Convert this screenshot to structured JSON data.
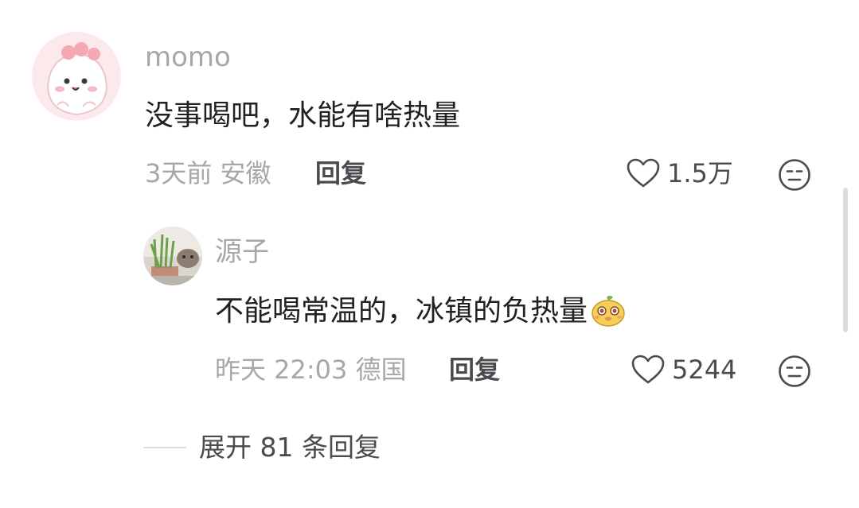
{
  "comment": {
    "username": "momo",
    "text": "没事喝吧，水能有啥热量",
    "time": "3天前",
    "location": "安徽",
    "reply_label": "回复",
    "likes": "1.5万"
  },
  "reply": {
    "username": "源子",
    "text": "不能喝常温的，冰镇的负热量",
    "time": "昨天 22:03",
    "location": "德国",
    "reply_label": "回复",
    "likes": "5244"
  },
  "expand": {
    "label": "展开 81 条回复"
  },
  "icons": {
    "like": "heart-outline-icon",
    "more": "meh-face-icon",
    "emoji": "cute-yellow-face-emoji"
  },
  "colors": {
    "meta_text": "#a7a7ab",
    "body_text": "#202124",
    "action_text": "#4a4a4f"
  }
}
